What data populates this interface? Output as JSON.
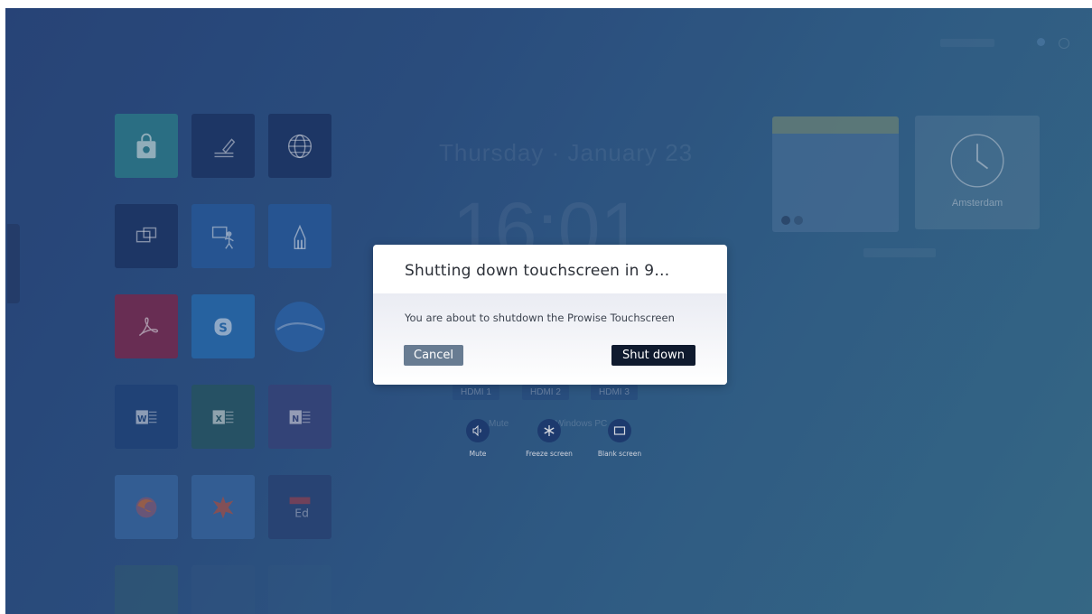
{
  "dialog": {
    "title": "Shutting down touchscreen in 9…",
    "message": "You are about to shutdown the Prowise Touchscreen",
    "cancel_label": "Cancel",
    "shutdown_label": "Shut down"
  },
  "quick_actions": [
    {
      "label": "Mute",
      "icon": "speaker-icon"
    },
    {
      "label": "Freeze screen",
      "icon": "snowflake-icon"
    },
    {
      "label": "Blank screen",
      "icon": "monitor-icon"
    }
  ],
  "background": {
    "date": "Thursday · January 23",
    "time": "16:01",
    "clock_city": "Amsterdam",
    "sources": [
      "HDMI 1",
      "HDMI 2",
      "HDMI 3"
    ],
    "ghost_mute": "Mute",
    "ghost_windows": "Windows PC"
  },
  "colors": {
    "desktop": "#2f5688",
    "dialog_bg": "#ffffff",
    "cancel_bg": "#687c92",
    "shutdown_bg": "#0f1a2e",
    "quick_action_bg": "#1f3f76"
  }
}
